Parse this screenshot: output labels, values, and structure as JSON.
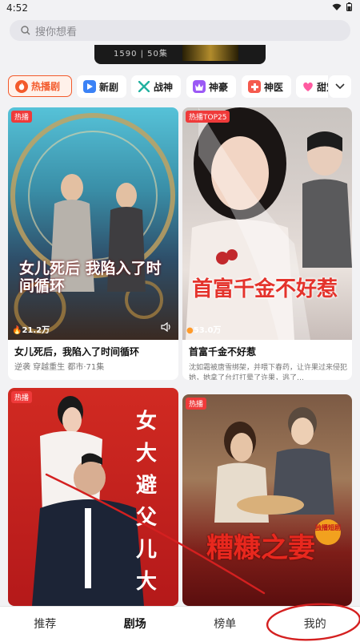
{
  "status": {
    "time": "4:52"
  },
  "search": {
    "placeholder": "搜你想看"
  },
  "banner": {
    "text": "1590 | 50集"
  },
  "tabs": [
    {
      "label": "热播剧",
      "icon": "flame-icon",
      "active": true,
      "color": "#f35a2b"
    },
    {
      "label": "新剧",
      "icon": "play-icon",
      "color": "#3b82f6"
    },
    {
      "label": "战神",
      "icon": "crossed-swords-icon",
      "color": "#21b0a0"
    },
    {
      "label": "神豪",
      "icon": "crown-icon",
      "color": "#9b59f5"
    },
    {
      "label": "神医",
      "icon": "medkit-icon",
      "color": "#f55a4e"
    },
    {
      "label": "甜宠",
      "icon": "heart-icon",
      "color": "#ff5aa0"
    }
  ],
  "cards": [
    {
      "badge": "热播",
      "views": "21.2万",
      "title": "女儿死后，我陷入了时间循环",
      "meta": "逆袭 穿越重生 都市·71集",
      "poster_text": "女儿死后 我陷入了时间循环"
    },
    {
      "badge": "热播TOP25",
      "views": "53.0万",
      "title": "首富千金不好惹",
      "meta": "沈如霜被唐雪绑架，并喂下春药，让许果过来侵犯她，她拿了台灯打晕了许果，逃了…",
      "poster_text": "首富千金不好惹"
    },
    {
      "badge": "热播",
      "poster_text": "女大避父儿大"
    },
    {
      "badge": "热播",
      "poster_text": "糟糠之妻",
      "sticker": "独播短剧"
    }
  ],
  "nav": [
    {
      "label": "推荐"
    },
    {
      "label": "剧场",
      "active": true
    },
    {
      "label": "榜单"
    },
    {
      "label": "我的"
    }
  ],
  "colors": {
    "accent": "#f35a2b",
    "badge": "#ef3a3a",
    "annotation": "#d42020"
  }
}
